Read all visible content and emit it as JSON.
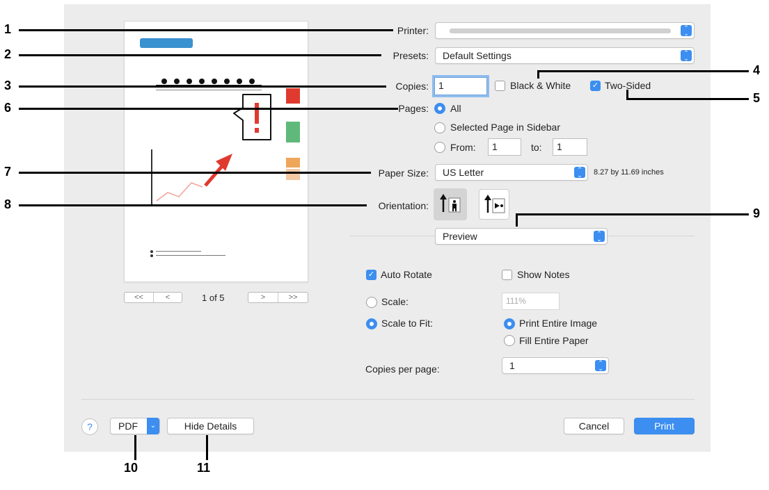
{
  "printer": {
    "label": "Printer:",
    "value": ""
  },
  "presets": {
    "label": "Presets:",
    "value": "Default Settings"
  },
  "copies": {
    "label": "Copies:",
    "value": "1",
    "black_white": "Black & White",
    "two_sided": "Two-Sided"
  },
  "pages": {
    "label": "Pages:",
    "all": "All",
    "selected": "Selected Page in Sidebar",
    "from": "From:",
    "from_value": "1",
    "to": "to:",
    "to_value": "1"
  },
  "paper": {
    "label": "Paper Size:",
    "value": "US Letter",
    "dimensions": "8.27 by 11.69 inches"
  },
  "orientation": {
    "label": "Orientation:"
  },
  "app_menu": {
    "value": "Preview"
  },
  "options": {
    "auto_rotate": "Auto Rotate",
    "show_notes": "Show Notes",
    "scale": "Scale:",
    "scale_value": "111%",
    "scale_to_fit": "Scale to Fit:",
    "print_entire": "Print Entire Image",
    "fill_paper": "Fill Entire Paper",
    "copies_per_page": "Copies per page:",
    "copies_per_page_value": "1"
  },
  "preview": {
    "page_indicator": "1 of 5",
    "first": "<<",
    "prev": "<",
    "next": ">",
    "last": ">>",
    "alert_mark": "!"
  },
  "footer": {
    "help": "?",
    "pdf": "PDF",
    "hide_details": "Hide Details",
    "cancel": "Cancel",
    "print": "Print"
  },
  "callouts": [
    "1",
    "2",
    "3",
    "4",
    "5",
    "6",
    "7",
    "8",
    "9",
    "10",
    "11"
  ],
  "colors": {
    "accent": "#3c8ef0",
    "dialog_bg": "#ececec",
    "callout": "#000000"
  }
}
